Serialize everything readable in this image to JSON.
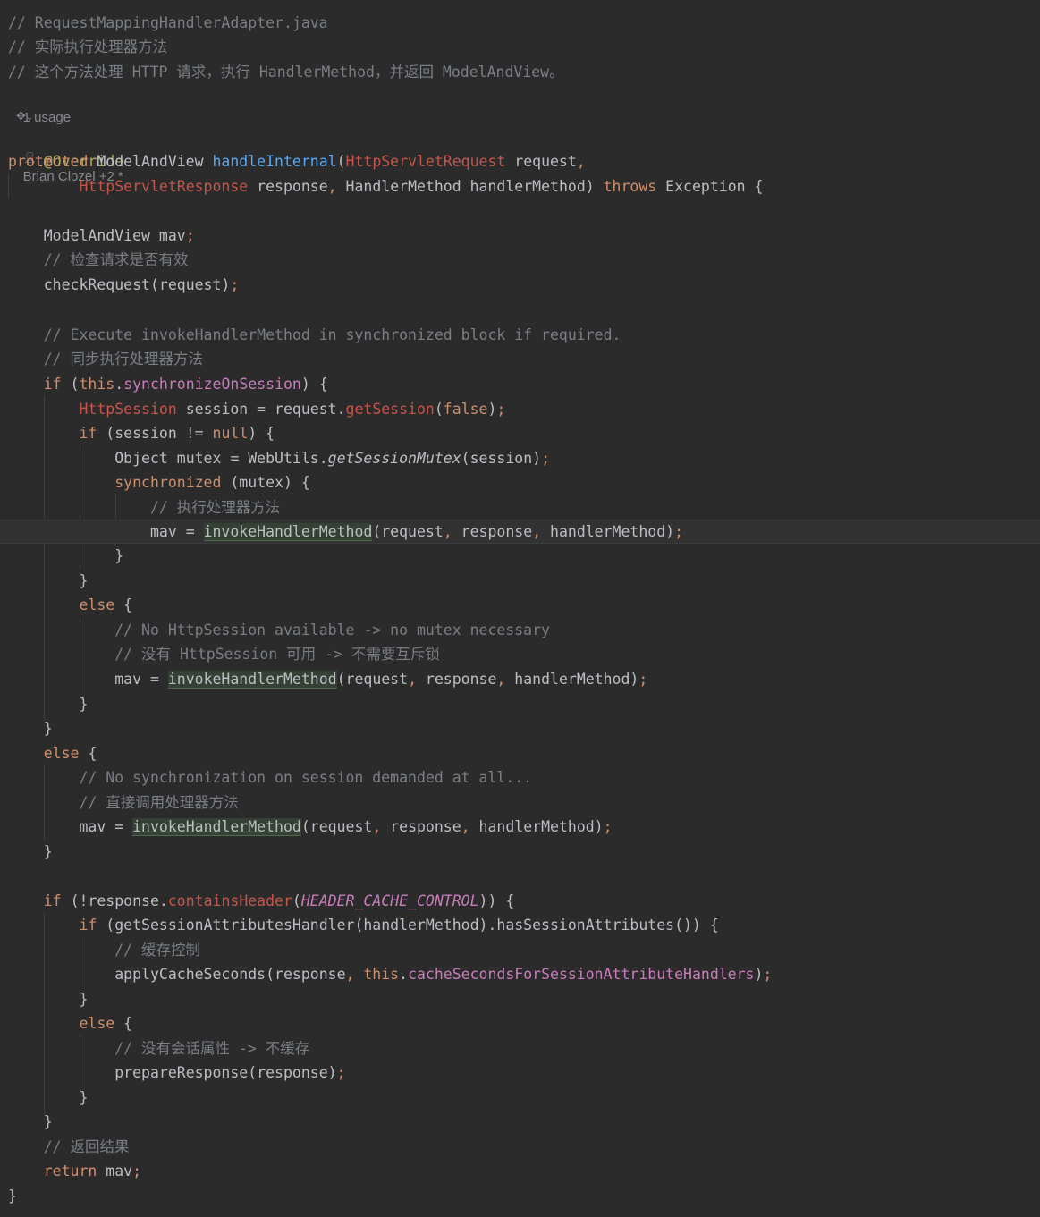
{
  "header_comments": [
    "// RequestMappingHandlerAdapter.java",
    "// 实际执行处理器方法",
    "// 这个方法处理 HTTP 请求，执行 HandlerMethod，并返回 ModelAndView。"
  ],
  "inlay": {
    "usage": "1 usage",
    "author": "Brian Clozel +2 *"
  },
  "code": {
    "annotation": "@Override",
    "sig_protected": "protected",
    "sig_return": "ModelAndView",
    "sig_name": "handleInternal",
    "sig_type1": "HttpServletRequest",
    "sig_param1": "request",
    "sig_type2": "HttpServletResponse",
    "sig_param2": "response",
    "sig_type3": "HandlerMethod",
    "sig_param3": "handlerMethod",
    "sig_throws": "throws",
    "sig_exception": "Exception",
    "mav_decl_type": "ModelAndView",
    "mav_decl_var": "mav",
    "comment_check": "// 检查请求是否有效",
    "check_call": "checkRequest(request)",
    "comment_exec_en": "// Execute invokeHandlerMethod in synchronized block if required.",
    "comment_exec_zh": "// 同步执行处理器方法",
    "kw_if": "if",
    "kw_this": "this",
    "field_sync": "synchronizeOnSession",
    "type_session": "HttpSession",
    "session_decl": "session = request.",
    "get_session": "getSession",
    "kw_false": "false",
    "cond_session": "(session != ",
    "kw_null": "null",
    "mutex_decl": "Object mutex = WebUtils.",
    "get_mutex": "getSessionMutex",
    "mutex_arg": "(session)",
    "kw_synchronized": "synchronized",
    "sync_arg": "(mutex) {",
    "comment_invoke": "// 执行处理器方法",
    "mav_assign": "mav = ",
    "invoke_name": "invokeHandlerMethod",
    "invoke_args_a": "(request",
    "invoke_args_b": " response",
    "invoke_args_c": " handlerMethod)",
    "kw_else": "else",
    "comment_nosession_en": "// No HttpSession available -> no mutex necessary",
    "comment_nosession_zh": "// 没有 HttpSession 可用 -> 不需要互斥锁",
    "comment_nosync_en": "// No synchronization on session demanded at all...",
    "comment_nosync_zh": "// 直接调用处理器方法",
    "cond_resp": "(!response.",
    "contains_header": "containsHeader",
    "header_const": "HEADER_CACHE_CONTROL",
    "cond_attrs": "(getSessionAttributesHandler(handlerMethod).hasSessionAttributes()) {",
    "comment_cache": "// 缓存控制",
    "apply_cache": "applyCacheSeconds(response",
    "field_cache": "cacheSecondsForSessionAttributeHandlers",
    "comment_nocache": "// 没有会话属性 -> 不缓存",
    "prepare_call": "prepareResponse(response)",
    "comment_return": "// 返回结果",
    "kw_return": "return",
    "return_var": " mav",
    "brace_open": "{",
    "brace_close": "}",
    "semi": ";",
    "comma": ","
  },
  "colors": {
    "background": "#2b2b2b",
    "text": "#bcbec4",
    "keyword": "#cf8e6d",
    "comment": "#7a7e85",
    "annotation": "#b3ae60",
    "method_decl": "#56a8f5",
    "field": "#c77dbb",
    "type_highlight": "#c8554a"
  },
  "icons": {
    "user": "person-icon",
    "gear": "ai-assistant-icon"
  }
}
